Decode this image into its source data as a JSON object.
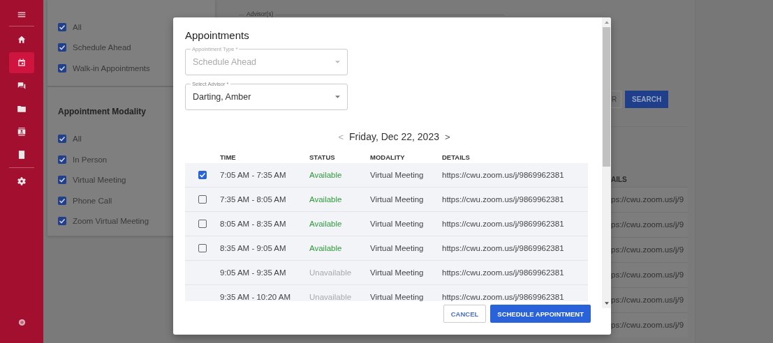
{
  "sidebar": {
    "items": [
      {
        "selected": false
      },
      {
        "selected": true
      },
      {
        "selected": false
      },
      {
        "selected": false
      },
      {
        "selected": false
      },
      {
        "selected": false
      },
      {
        "selected": false
      }
    ]
  },
  "filters": {
    "groups": [
      {
        "items": [
          {
            "label": "All",
            "checked": true
          },
          {
            "label": "Schedule Ahead",
            "checked": true
          },
          {
            "label": "Walk-in Appointments",
            "checked": true
          }
        ]
      },
      {
        "title": "Appointment Modality",
        "items": [
          {
            "label": "All",
            "checked": true
          },
          {
            "label": "In Person",
            "checked": true
          },
          {
            "label": "Virtual Meeting",
            "checked": true
          },
          {
            "label": "Phone Call",
            "checked": true
          },
          {
            "label": "Zoom Virtual Meeting",
            "checked": true
          }
        ]
      }
    ]
  },
  "advisor_field": {
    "label": "Advisor(s)"
  },
  "background_buttons": [
    "R",
    "SEARCH"
  ],
  "background_table": {
    "header": "AILS",
    "rows": [
      "ps://cwu.zoom.us/j/9",
      "ps://cwu.zoom.us/j/9",
      "ps://cwu.zoom.us/j/9",
      "ps://cwu.zoom.us/j/9",
      "ps://cwu.zoom.us/j/9",
      "ps://cwu.zoom.us/j/9"
    ]
  },
  "dialog": {
    "title": "Appointments",
    "appointment_type": {
      "label": "Appointment Type *",
      "value": "Schedule Ahead",
      "disabled": true
    },
    "advisor": {
      "label": "Select Advisor *",
      "value": "Darting, Amber",
      "disabled": false
    },
    "date_nav": {
      "prev": "<",
      "date": "Friday, Dec 22, 2023",
      "next": ">"
    },
    "table": {
      "columns": [
        "TIME",
        "STATUS",
        "MODALITY",
        "DETAILS"
      ],
      "rows": [
        {
          "kind": "selectable",
          "checked": true,
          "time": "7:05 AM - 7:35 AM",
          "status": "Available",
          "modality": "Virtual Meeting",
          "details": "https://cwu.zoom.us/j/9869962381"
        },
        {
          "kind": "selectable",
          "checked": false,
          "time": "7:35 AM - 8:05 AM",
          "status": "Available",
          "modality": "Virtual Meeting",
          "details": "https://cwu.zoom.us/j/9869962381"
        },
        {
          "kind": "selectable",
          "checked": false,
          "time": "8:05 AM - 8:35 AM",
          "status": "Available",
          "modality": "Virtual Meeting",
          "details": "https://cwu.zoom.us/j/9869962381"
        },
        {
          "kind": "selectable",
          "checked": false,
          "time": "8:35 AM - 9:05 AM",
          "status": "Available",
          "modality": "Virtual Meeting",
          "details": "https://cwu.zoom.us/j/9869962381"
        },
        {
          "kind": "unavailable",
          "time": "9:05 AM - 9:35 AM",
          "status": "Unavailable",
          "modality": "Virtual Meeting",
          "details": "https://cwu.zoom.us/j/9869962381"
        },
        {
          "kind": "unavailable",
          "time": "9:35 AM - 10:20 AM",
          "status": "Unavailable",
          "modality": "Virtual Meeting",
          "details": "https://cwu.zoom.us/j/9869962381"
        }
      ]
    },
    "buttons": {
      "cancel": "CANCEL",
      "primary": "SCHEDULE APPOINTMENT"
    }
  }
}
